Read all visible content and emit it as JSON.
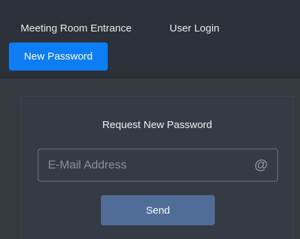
{
  "nav": {
    "items": [
      {
        "label": "Meeting Room Entrance"
      },
      {
        "label": "User Login"
      },
      {
        "label": "New Password",
        "active": true
      }
    ],
    "active_color": "#0d7df3"
  },
  "form": {
    "title": "Request New Password",
    "email": {
      "placeholder": "E-Mail Address",
      "value": "",
      "icon": "at-icon",
      "icon_glyph": "@"
    },
    "submit_label": "Send",
    "submit_color": "#4f6d96"
  },
  "theme": {
    "background": "#343a40"
  }
}
